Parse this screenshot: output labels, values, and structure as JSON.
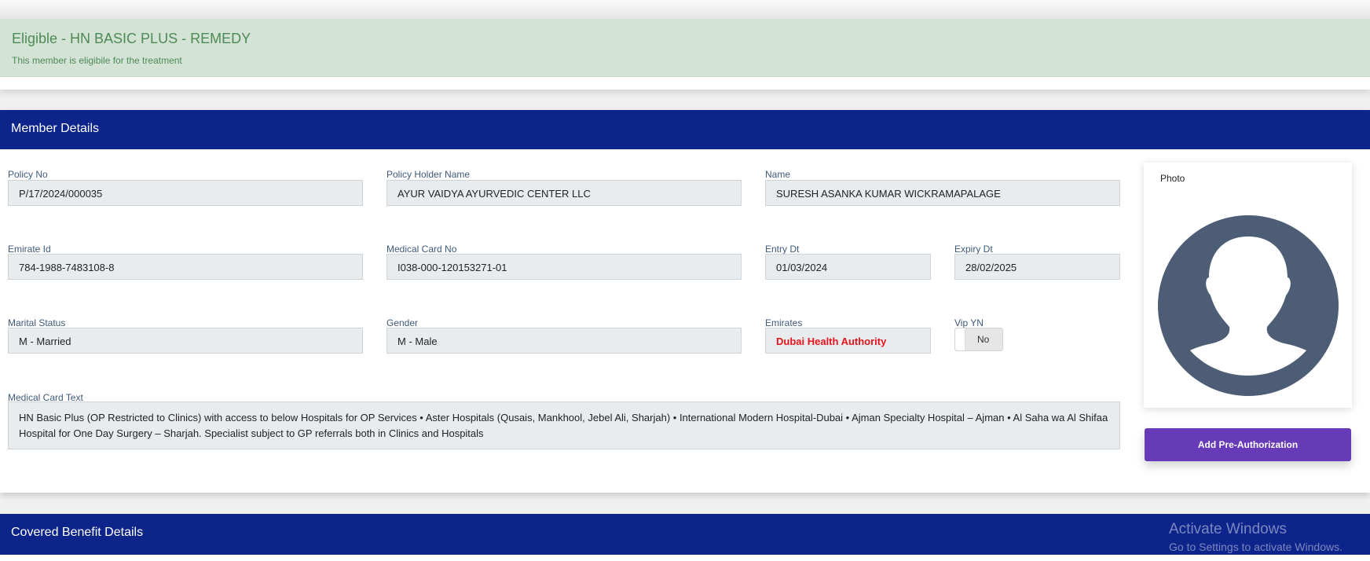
{
  "eligibility": {
    "title": "Eligible - HN BASIC PLUS - REMEDY",
    "message": "This member is eligibile for the treatment",
    "color": "#4f8a56"
  },
  "member_details": {
    "header": "Member Details",
    "fields": {
      "policy_no": {
        "label": "Policy No",
        "value": "P/17/2024/000035"
      },
      "policy_holder": {
        "label": "Policy Holder Name",
        "value": "AYUR VAIDYA AYURVEDIC CENTER LLC"
      },
      "name": {
        "label": "Name",
        "value": "SURESH ASANKA KUMAR WICKRAMAPALAGE"
      },
      "emirate_id": {
        "label": "Emirate Id",
        "value": "784-1988-7483108-8"
      },
      "medical_card_no": {
        "label": "Medical Card No",
        "value": "I038-000-120153271-01"
      },
      "entry_dt": {
        "label": "Entry Dt",
        "value": "01/03/2024"
      },
      "expiry_dt": {
        "label": "Expiry Dt",
        "value": "28/02/2025"
      },
      "marital_status": {
        "label": "Marital Status",
        "value": "M - Married"
      },
      "gender": {
        "label": "Gender",
        "value": "M - Male"
      },
      "emirates": {
        "label": "Emirates",
        "value": "Dubai Health Authority",
        "color": "#e8131b"
      },
      "vip": {
        "label": "Vip YN",
        "value": "No"
      },
      "medical_card_text": {
        "label": "Medical Card Text",
        "value": "HN Basic Plus (OP Restricted to Clinics) with access to below Hospitals for OP Services • Aster Hospitals (Qusais, Mankhool, Jebel Ali, Sharjah) • International Modern Hospital-Dubai • Ajman Specialty Hospital – Ajman • Al Saha wa Al Shifaa Hospital for One Day Surgery – Sharjah. Specialist subject to GP referrals both in Clinics and Hospitals"
      }
    },
    "photo_label": "Photo",
    "add_preauth_label": "Add Pre-Authorization"
  },
  "covered_benefits": {
    "header": "Covered Benefit Details"
  },
  "watermark": {
    "line1": "Activate Windows",
    "line2": "Go to Settings to activate Windows."
  },
  "colors": {
    "header": "#0d248a",
    "button": "#673ab7"
  }
}
